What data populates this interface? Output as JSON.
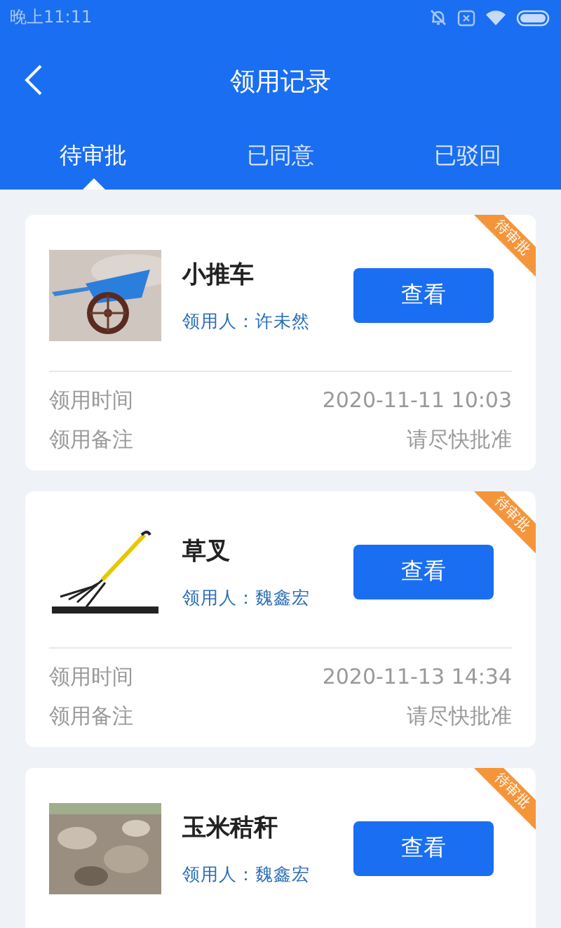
{
  "status_bar": {
    "time": "晚上11:11"
  },
  "header": {
    "title": "领用记录"
  },
  "tabs": [
    {
      "label": "待审批",
      "selected": true
    },
    {
      "label": "已同意",
      "selected": false
    },
    {
      "label": "已驳回",
      "selected": false
    }
  ],
  "records": [
    {
      "name": "小推车",
      "recipient": "领用人：许未然",
      "button": "查看",
      "badge": "待审批",
      "rows": [
        {
          "label": "领用时间",
          "value": "2020-11-11 10:03"
        },
        {
          "label": "领用备注",
          "value": "请尽快批准"
        }
      ]
    },
    {
      "name": "草叉",
      "recipient": "领用人：魏鑫宏",
      "button": "查看",
      "badge": "待审批",
      "rows": [
        {
          "label": "领用时间",
          "value": "2020-11-13 14:34"
        },
        {
          "label": "领用备注",
          "value": "请尽快批准"
        }
      ]
    },
    {
      "name": "玉米秸秆",
      "recipient": "领用人：魏鑫宏",
      "button": "查看",
      "badge": "待审批"
    }
  ]
}
